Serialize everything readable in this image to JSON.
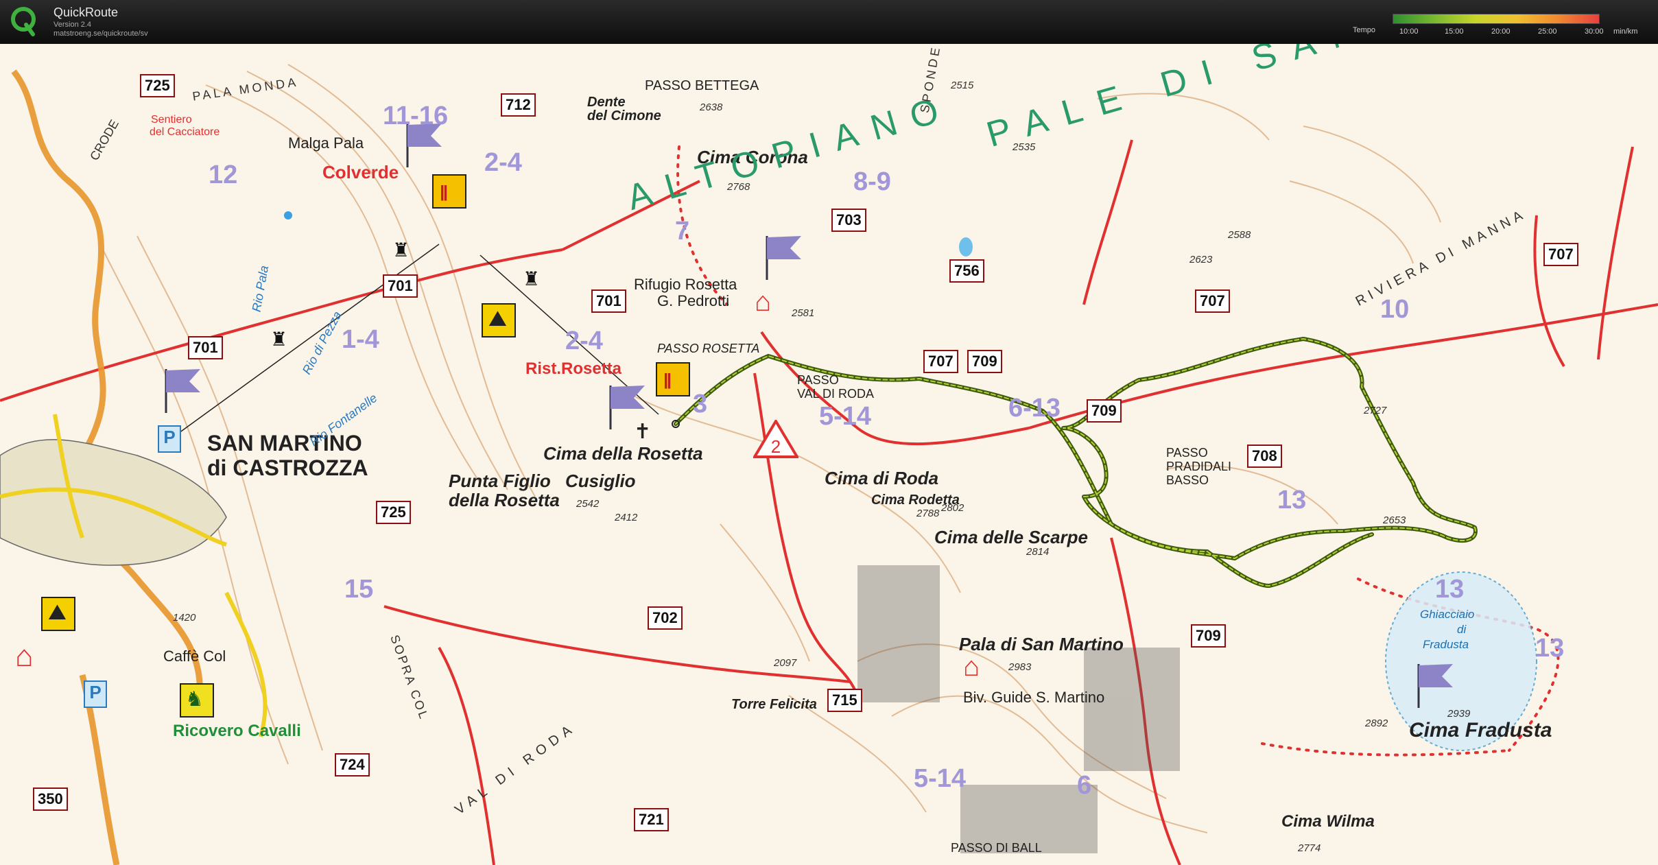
{
  "app": {
    "title": "QuickRoute",
    "version": "Version 2.4",
    "url": "matstroeng.se/quickroute/sv"
  },
  "legend": {
    "label": "Tempo",
    "ticks": [
      "10:00",
      "15:00",
      "20:00",
      "25:00",
      "30:00"
    ],
    "unit": "min/km"
  },
  "map_labels": {
    "san_martino": "SAN MARTINO",
    "di_castrozza": "di CASTROZZA",
    "malga_pala": "Malga Pala",
    "colverde": "Colverde",
    "sentiero1": "Sentiero",
    "sentiero2": "del Cacciatore",
    "crode": "CRODE",
    "pala_monda": "PALA MONDA",
    "passo_bettega": "PASSO BETTEGA",
    "dente1": "Dente",
    "dente2": "del Cimone",
    "cima_corona": "Cima Corona",
    "altopiano": "ALTOPIANO",
    "pale_di_san": "PALE DI SAN",
    "rifugio1": "Rifugio Rosetta",
    "rifugio2": "G. Pedrotti",
    "passo_rosetta": "PASSO ROSETTA",
    "rist_rosetta": "Rist.Rosetta",
    "passo_val1": "PASSO",
    "passo_val2": "VAL DI RODA",
    "cima_rosetta": "Cima della Rosetta",
    "punta1": "Punta Figlio",
    "punta2": "della Rosetta",
    "cusiglio": "Cusiglio",
    "cima_di_roda": "Cima di Roda",
    "cima_rodetta": "Cima Rodetta",
    "cima_scarpe": "Cima delle Scarpe",
    "pradidali1": "PASSO",
    "pradidali2": "PRADIDALI",
    "pradidali3": "BASSO",
    "pala_sm": "Pala di San Martino",
    "biv": "Biv. Guide S. Martino",
    "ghiacciaio1": "Ghiacciaio",
    "ghiacciaio2": "di",
    "ghiacciaio3": "Fradusta",
    "cima_fradusta": "Cima Fradusta",
    "cima_wilma": "Cima Wilma",
    "torre_felicita": "Torre Felicita",
    "passo_di_ball": "PASSO DI BALL",
    "sopra_col": "SOPRA COL",
    "val_di_roda": "VAL DI RODA",
    "caffe_col": "Caffè Col",
    "ricovero": "Ricovero Cavalli",
    "riviera": "RIVIERA DI MANNA",
    "sponde": "SPONDE",
    "rio_pala": "Rio Pala",
    "rio_pezza": "Rio di Pezza",
    "rio_fontanelle": "Rio Fontanelle"
  },
  "trail_numbers": [
    "725",
    "712",
    "701",
    "701",
    "701",
    "703",
    "756",
    "707",
    "707",
    "707",
    "709",
    "709",
    "708",
    "702",
    "709",
    "715",
    "724",
    "721",
    "350",
    "725",
    "724"
  ],
  "zone_labels": [
    "11-16",
    "2-4",
    "12",
    "8-9",
    "7",
    "1-4",
    "2-4",
    "3",
    "5-14",
    "6-13",
    "10",
    "13",
    "13",
    "13",
    "15",
    "5-14",
    "6"
  ],
  "elevations": [
    "2638",
    "2515",
    "2535",
    "2768",
    "2588",
    "2623",
    "2581",
    "2542",
    "2412",
    "2788",
    "2802",
    "2814",
    "2727",
    "2653",
    "2983",
    "2097",
    "2939",
    "2892",
    "2774",
    "1420"
  ],
  "colors": {
    "route_dark": "#3c5a10",
    "route_light": "#b8d030",
    "trail_red": "#e03030",
    "contour": "#d8a878",
    "lavender": "#a096d8"
  },
  "icons": [
    "flag-icon",
    "restaurant-icon",
    "gondola-icon",
    "climbing-icon",
    "hut-icon",
    "parking-icon",
    "horse-icon",
    "cross-icon",
    "warning-icon"
  ]
}
